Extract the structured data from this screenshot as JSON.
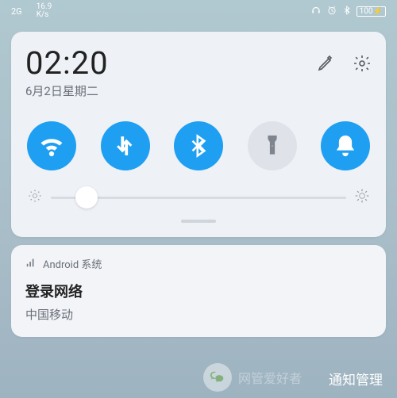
{
  "statusbar": {
    "network_badge": "2G",
    "speed_top": "16.9",
    "speed_unit": "K/s",
    "battery_text": "100"
  },
  "panel": {
    "time": "02:20",
    "date": "6月2日星期二",
    "toggles": {
      "wifi_on": true,
      "data_on": true,
      "bluetooth_on": true,
      "flashlight_on": false,
      "dnd_on": true
    },
    "brightness_percent": 12
  },
  "notification": {
    "app_name": "Android 系统",
    "title": "登录网络",
    "body": "中国移动"
  },
  "footer": {
    "manage_label": "通知管理"
  },
  "watermark": {
    "label": "网管爱好者"
  }
}
